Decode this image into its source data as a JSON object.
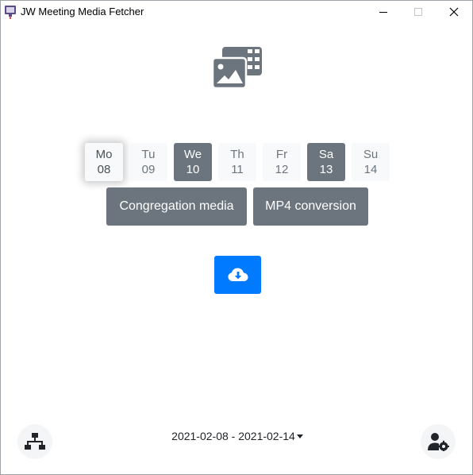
{
  "window": {
    "title": "JW Meeting Media Fetcher",
    "controls": {
      "minimize_icon": "minimize-icon",
      "maximize_icon": "maximize-icon",
      "close_icon": "close-icon"
    }
  },
  "hero": {
    "icon": "photo-video-icon"
  },
  "days": [
    {
      "name": "Mo",
      "date": "08",
      "state": "today"
    },
    {
      "name": "Tu",
      "date": "09",
      "state": "normal"
    },
    {
      "name": "We",
      "date": "10",
      "state": "active"
    },
    {
      "name": "Th",
      "date": "11",
      "state": "normal"
    },
    {
      "name": "Fr",
      "date": "12",
      "state": "normal"
    },
    {
      "name": "Sa",
      "date": "13",
      "state": "active"
    },
    {
      "name": "Su",
      "date": "14",
      "state": "normal"
    }
  ],
  "actions": {
    "congregation_media": "Congregation media",
    "mp4_conversion": "MP4 conversion",
    "download_icon": "cloud-download-icon"
  },
  "footer": {
    "date_range": "2021-02-08 - 2021-02-14",
    "network_icon": "network-icon",
    "settings_icon": "user-cog-icon"
  },
  "colors": {
    "accent": "#007bff",
    "secondary": "#6c757d",
    "light": "#f8f9fa"
  }
}
